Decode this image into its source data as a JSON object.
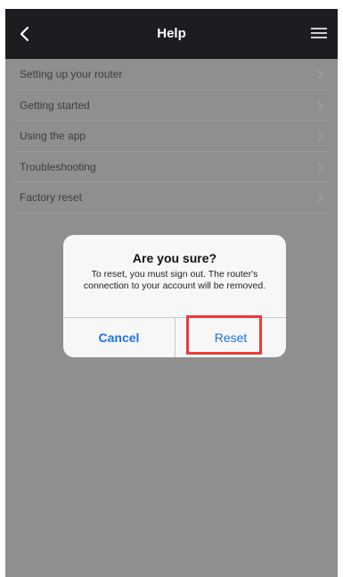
{
  "header": {
    "title": "Help",
    "back_icon": "chevron-left-icon",
    "menu_icon": "hamburger-menu-icon"
  },
  "help_items": [
    {
      "label": "Setting up your router"
    },
    {
      "label": "Getting started"
    },
    {
      "label": "Using the app"
    },
    {
      "label": "Troubleshooting"
    },
    {
      "label": "Factory reset"
    }
  ],
  "dialog": {
    "title": "Are you sure?",
    "message": "To reset, you must sign out. The router's connection to your account will be removed.",
    "cancel_label": "Cancel",
    "reset_label": "Reset"
  },
  "colors": {
    "header_bg": "#1b1d20",
    "overlay_bg": "#8f8f8f",
    "dialog_button": "#1d73e8",
    "highlight": "#ea3b3b"
  }
}
